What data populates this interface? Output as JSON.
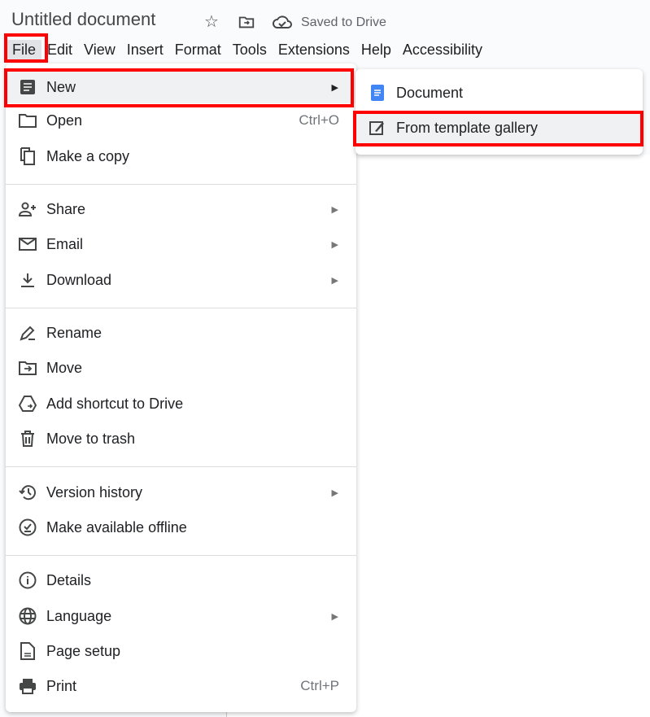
{
  "header": {
    "title": "Untitled document",
    "status": "Saved to Drive",
    "icons": [
      "star-icon",
      "move-folder-icon",
      "cloud-done-icon"
    ]
  },
  "menubar": [
    "File",
    "Edit",
    "View",
    "Insert",
    "Format",
    "Tools",
    "Extensions",
    "Help",
    "Accessibility"
  ],
  "file_menu": {
    "items": [
      {
        "label": "New",
        "icon": "document-icon",
        "submenu": true
      },
      {
        "label": "Open",
        "icon": "folder-icon",
        "shortcut": "Ctrl+O"
      },
      {
        "label": "Make a copy",
        "icon": "copy-icon"
      },
      {
        "label": "Share",
        "icon": "person-add-icon",
        "submenu": true
      },
      {
        "label": "Email",
        "icon": "mail-icon",
        "submenu": true
      },
      {
        "label": "Download",
        "icon": "download-icon",
        "submenu": true
      },
      {
        "label": "Rename",
        "icon": "rename-icon"
      },
      {
        "label": "Move",
        "icon": "move-folder-icon"
      },
      {
        "label": "Add shortcut to Drive",
        "icon": "drive-shortcut-icon"
      },
      {
        "label": "Move to trash",
        "icon": "trash-icon"
      },
      {
        "label": "Version history",
        "icon": "history-icon",
        "submenu": true
      },
      {
        "label": "Make available offline",
        "icon": "offline-icon"
      },
      {
        "label": "Details",
        "icon": "info-icon"
      },
      {
        "label": "Language",
        "icon": "globe-icon",
        "submenu": true
      },
      {
        "label": "Page setup",
        "icon": "page-icon"
      },
      {
        "label": "Print",
        "icon": "print-icon",
        "shortcut": "Ctrl+P"
      }
    ]
  },
  "new_submenu": {
    "items": [
      {
        "label": "Document",
        "icon": "google-docs-icon",
        "color": "#4285f4"
      },
      {
        "label": "From template gallery",
        "icon": "template-icon"
      }
    ]
  },
  "highlight_color": "#ff0000"
}
